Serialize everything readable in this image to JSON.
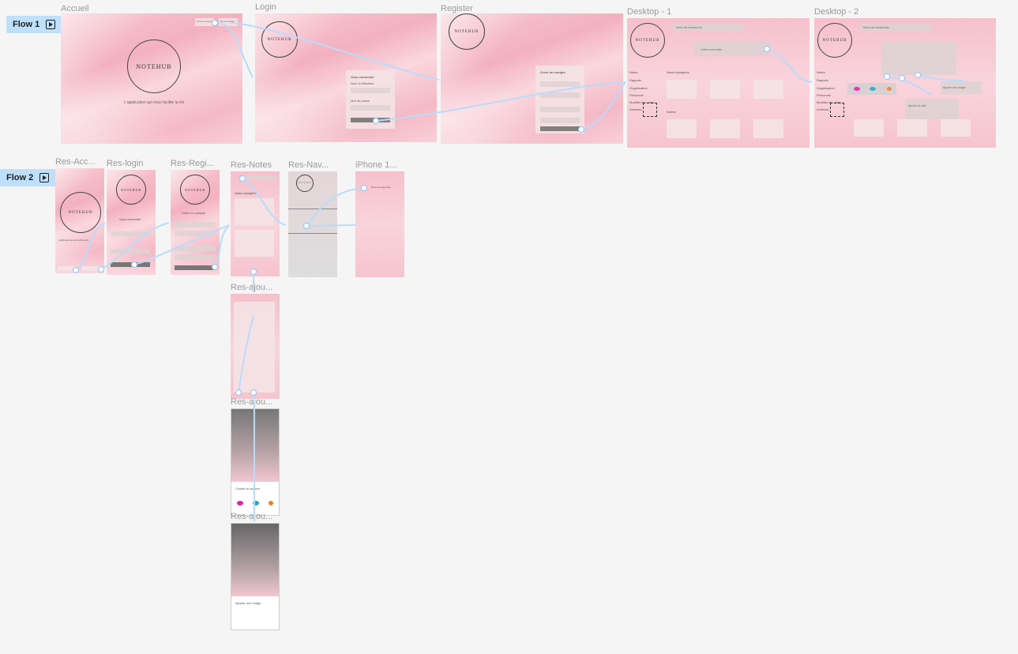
{
  "flows": [
    {
      "label": "Flow 1"
    },
    {
      "label": "Flow 2"
    }
  ],
  "frames": {
    "accueil": {
      "title": "Accueil",
      "logo": "NOTEHUB",
      "tagline": "L'application qui vous facilite la vie",
      "btn1": "Créer un compte",
      "btn2": "Se connecter"
    },
    "login": {
      "title": "Login",
      "logo": "NOTEHUB",
      "heading": "Vous connecter",
      "field1": "Nom d'utilisateur",
      "field2": "Mot de passe",
      "cta": "Connexion"
    },
    "register": {
      "title": "Register",
      "logo": "NOTEHUB",
      "heading": "Créer un compte",
      "cta": "Connexion"
    },
    "desktop1": {
      "title": "Desktop - 1",
      "logo": "NOTEHUB",
      "search": "Nom de recherche",
      "new_note": "Créer une note",
      "nav": [
        "Notes",
        "Rappels",
        "Organisation",
        "Personnel",
        "Modifier les notes",
        "Archives"
      ],
      "section": "Notes épinglées",
      "section2": "Autres"
    },
    "desktop2": {
      "title": "Desktop - 2",
      "logo": "NOTEHUB",
      "search": "Nom de recherche",
      "nav": [
        "Notes",
        "Rappels",
        "Organisation",
        "Personnel",
        "Modifier les notes",
        "Archives"
      ],
      "colors": [
        "#e020b0",
        "#20a8c0",
        "#f08020"
      ],
      "popup1": "Ajouter une image",
      "popup2": "Ajouter la note"
    },
    "resAccueil": {
      "title": "Res-Acc...",
      "logo": "NOTEHUB",
      "tagline": "L'application qui vous facilite la vie"
    },
    "resLogin": {
      "title": "Res-login",
      "logo": "NOTEHUB",
      "heading": "Vous connecter",
      "cta": "Connexion"
    },
    "resRegister": {
      "title": "Res-Regi...",
      "logo": "NOTEHUB",
      "heading": "Créer un compte",
      "cta": "Connexion"
    },
    "resNotes": {
      "title": "Res-Notes",
      "section": "Notes épinglées"
    },
    "resNav": {
      "title": "Res-Nav...",
      "logo": "NOTEHUB"
    },
    "iphone": {
      "title": "iPhone 1...",
      "search": "Nom de recherche"
    },
    "resAjout1": {
      "title": "Res-ajou..."
    },
    "resAjout2": {
      "title": "Res-ajou...",
      "label": "Choisir la couleur",
      "colors": [
        "#e020b0",
        "#20a8c0",
        "#f08020"
      ]
    },
    "resAjout3": {
      "title": "Res-ajou...",
      "label": "Ajouter une image"
    }
  }
}
